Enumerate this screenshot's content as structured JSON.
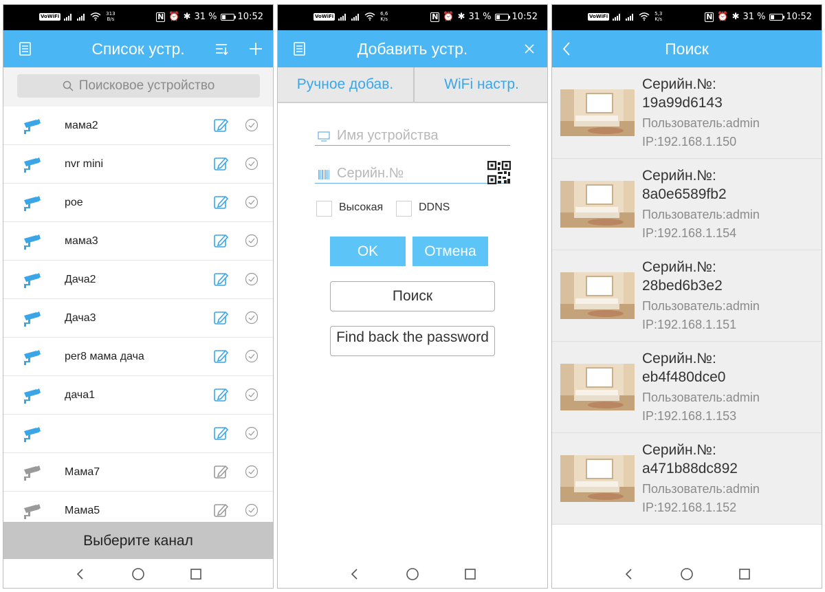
{
  "status_bars": [
    {
      "volte": "VoWiFi",
      "speed": "313",
      "speed_unit": "B/s",
      "battery": "31 %",
      "time": "10:52"
    },
    {
      "volte": "VoWiFi",
      "speed": "6,6",
      "speed_unit": "K/s",
      "battery": "31 %",
      "time": "10:52"
    },
    {
      "volte": "VoWiFi",
      "speed": "5,3",
      "speed_unit": "K/s",
      "battery": "31 %",
      "time": "10:52"
    }
  ],
  "device_list": {
    "title": "Список устр.",
    "search_placeholder": "Поисковое устройство",
    "devices": [
      {
        "name": "мама2",
        "online": true
      },
      {
        "name": "nvr mini",
        "online": true
      },
      {
        "name": "poe",
        "online": true
      },
      {
        "name": "мама3",
        "online": true
      },
      {
        "name": "Дача2",
        "online": true
      },
      {
        "name": "Дача3",
        "online": true
      },
      {
        "name": "per8 мама дача",
        "online": true
      },
      {
        "name": "дача1",
        "online": true
      },
      {
        "name": "",
        "online": true
      },
      {
        "name": "Мама7",
        "online": false
      },
      {
        "name": "Мама5",
        "online": false
      }
    ],
    "channel_button": "Выберите канал"
  },
  "add_device": {
    "title": "Добавить устр.",
    "tab_manual": "Ручное добав.",
    "tab_wifi": "WiFi настр.",
    "device_name_placeholder": "Имя устройства",
    "serial_placeholder": "Серийн.№",
    "checkbox_high": "Высокая",
    "checkbox_ddns": "DDNS",
    "ok_button": "OK",
    "cancel_button": "Отмена",
    "search_button": "Поиск",
    "find_password_button": "Find back the password"
  },
  "search": {
    "title": "Поиск",
    "results": [
      {
        "serial_label": "Серийн.№:",
        "serial": "19a99d6143",
        "user": "Пользователь:admin",
        "ip": "IP:192.168.1.150"
      },
      {
        "serial_label": "Серийн.№:",
        "serial": "8a0e6589fb2",
        "user": "Пользователь:admin",
        "ip": "IP:192.168.1.154"
      },
      {
        "serial_label": "Серийн.№:",
        "serial": "28bed6b3e2",
        "user": "Пользователь:admin",
        "ip": "IP:192.168.1.151"
      },
      {
        "serial_label": "Серийн.№:",
        "serial": "eb4f480dce0",
        "user": "Пользователь:admin",
        "ip": "IP:192.168.1.153"
      },
      {
        "serial_label": "Серийн.№:",
        "serial": "a471b88dc892",
        "user": "Пользователь:admin",
        "ip": "IP:192.168.1.152"
      }
    ]
  },
  "colors": {
    "accent": "#4ab6f3",
    "camera_online": "#3aa6e8",
    "camera_offline": "#9a9a9a"
  }
}
